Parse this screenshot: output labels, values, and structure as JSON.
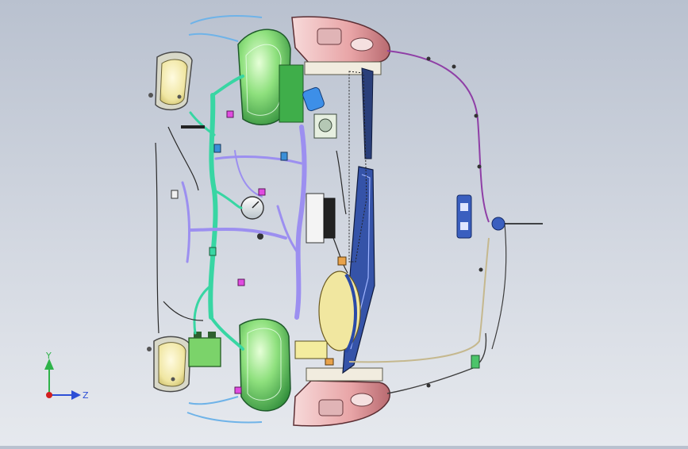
{
  "viewport": {
    "background_top": "#b9c1cf",
    "background_bottom": "#e6e9ee"
  },
  "triad": {
    "y_label": "Y",
    "z_label": "Z",
    "y_color": "#2fb34a",
    "z_color": "#2d4fd6",
    "origin_color": "#d21f1f"
  },
  "model": {
    "icon": "wiring-harness-assembly",
    "colors": {
      "headlamp": "#f3ecae",
      "wheelhouse": "#6fdc6a",
      "bumper": "#e7aaaa",
      "harness_teal": "#38d6a3",
      "harness_purple": "#9c8ff0",
      "harness_blue": "#5b7fd8",
      "radiator": "#2a3f7a",
      "battery": "#3fae4a",
      "gauge": "#e9edf0"
    }
  }
}
